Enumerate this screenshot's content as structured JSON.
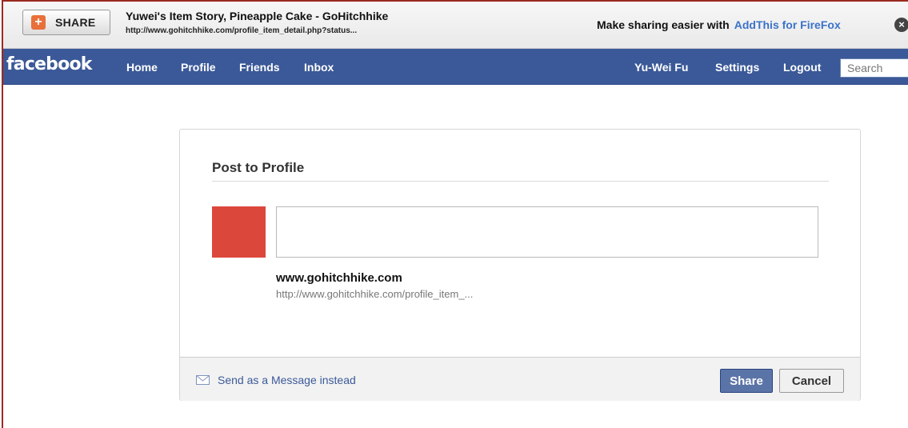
{
  "addthis": {
    "share_label": "SHARE",
    "page_title": "Yuwei's Item Story, Pineapple Cake - GoHitchhike",
    "page_url": "http://www.gohitchhike.com/profile_item_detail.php?status...",
    "promo_text": "Make sharing easier with",
    "promo_link": "AddThis for FireFox",
    "icons": {
      "share": "plus-icon",
      "close": "close-icon"
    }
  },
  "nav": {
    "logo": "facebook",
    "left_links": [
      "Home",
      "Profile",
      "Friends",
      "Inbox"
    ],
    "right_links": [
      "Yu-Wei Fu",
      "Settings",
      "Logout"
    ],
    "search_placeholder": "Search"
  },
  "dialog": {
    "title": "Post to Profile",
    "message_value": "",
    "attachment": {
      "domain": "www.gohitchhike.com",
      "url": "http://www.gohitchhike.com/profile_item_..."
    },
    "footer": {
      "send_message": "Send as a Message instead",
      "share_button": "Share",
      "cancel_button": "Cancel"
    }
  },
  "colors": {
    "facebook_blue": "#3b5998",
    "link_blue": "#3b72c8",
    "thumbnail": "#dc473c",
    "share_icon_orange": "#e8703a"
  }
}
